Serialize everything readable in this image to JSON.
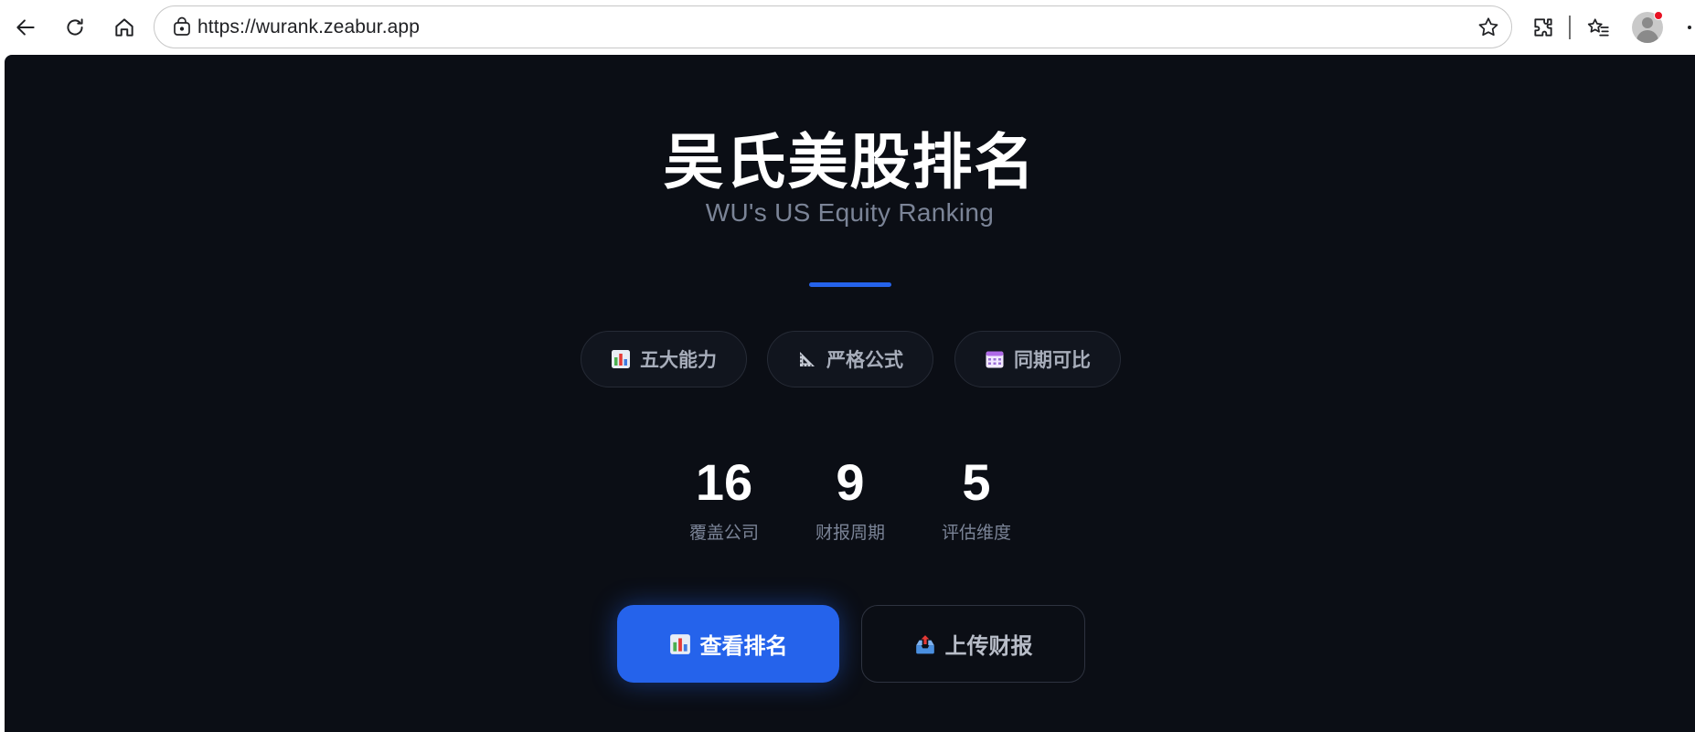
{
  "browser": {
    "url": "https://wurank.zeabur.app",
    "icons": [
      "back-icon",
      "reload-icon",
      "home-icon",
      "lock-icon",
      "star-icon",
      "extensions-icon",
      "favorites-icon",
      "profile-avatar",
      "more-icon"
    ]
  },
  "hero": {
    "title": "吴氏美股排名",
    "subtitle": "WU's US Equity Ranking"
  },
  "features": [
    {
      "icon": "bar-chart-icon",
      "label": "五大能力"
    },
    {
      "icon": "triangle-ruler-icon",
      "label": "严格公式"
    },
    {
      "icon": "calendar-icon",
      "label": "同期可比"
    }
  ],
  "stats": [
    {
      "value": "16",
      "label": "覆盖公司"
    },
    {
      "value": "9",
      "label": "财报周期"
    },
    {
      "value": "5",
      "label": "评估维度"
    }
  ],
  "actions": {
    "primary": {
      "icon": "bar-chart-icon",
      "label": "查看排名"
    },
    "secondary": {
      "icon": "outbox-tray-icon",
      "label": "上传财报"
    }
  },
  "colors": {
    "page_background": "#0b0e15",
    "accent": "#2563eb",
    "muted_text": "#7b8497"
  }
}
